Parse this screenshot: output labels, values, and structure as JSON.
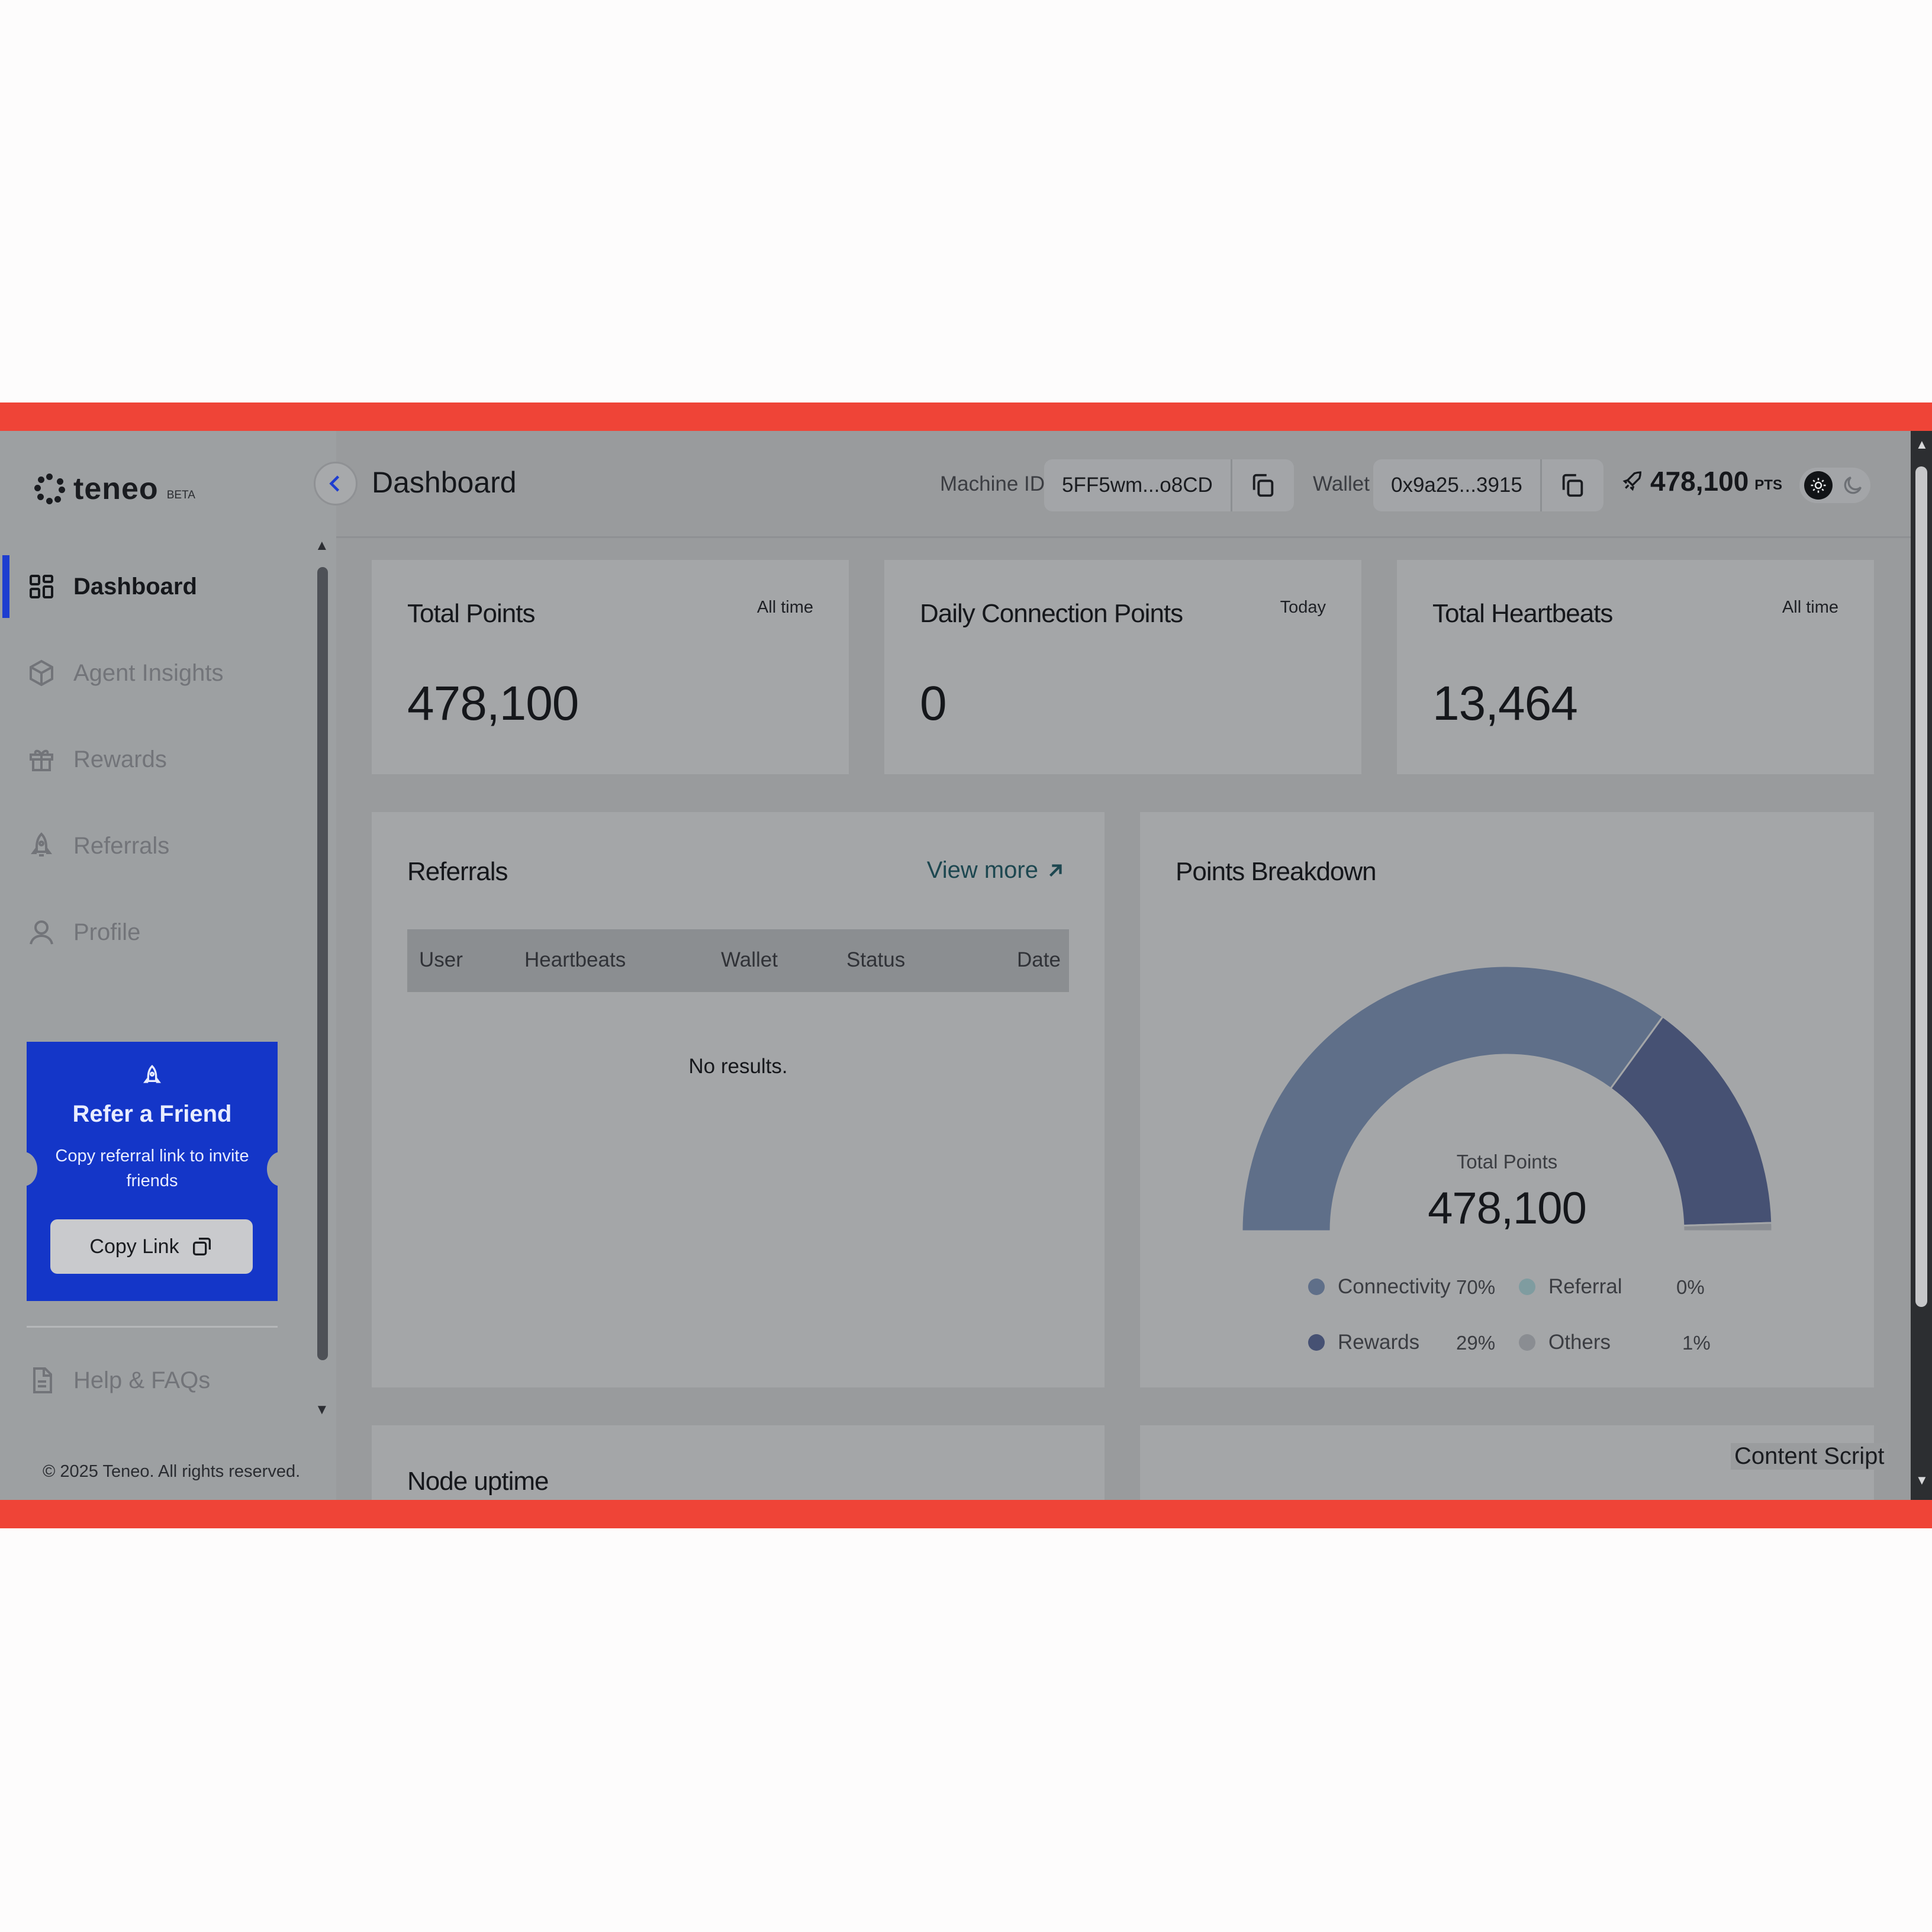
{
  "app": {
    "name": "teneo",
    "badge": "BETA"
  },
  "sidebar": {
    "items": [
      {
        "label": "Dashboard",
        "icon": "dashboard-grid-icon",
        "active": true
      },
      {
        "label": "Agent Insights",
        "icon": "cube-icon"
      },
      {
        "label": "Rewards",
        "icon": "gift-icon"
      },
      {
        "label": "Referrals",
        "icon": "rocket-icon"
      },
      {
        "label": "Profile",
        "icon": "user-icon"
      }
    ],
    "refer": {
      "title": "Refer a Friend",
      "subtitle": "Copy referral link to invite friends",
      "button": "Copy Link"
    },
    "help": "Help & FAQs",
    "copyright": "© 2025 Teneo. All rights reserved."
  },
  "header": {
    "title": "Dashboard",
    "machine_label": "Machine ID",
    "machine_id": "5FF5wm...o8CD",
    "wallet_label": "Wallet",
    "wallet": "0x9a25...3915",
    "points": "478,100",
    "points_unit": "PTS"
  },
  "stats": [
    {
      "title": "Total Points",
      "period": "All time",
      "value": "478,100"
    },
    {
      "title": "Daily Connection Points",
      "period": "Today",
      "value": "0"
    },
    {
      "title": "Total Heartbeats",
      "period": "All time",
      "value": "13,464"
    }
  ],
  "referrals": {
    "title": "Referrals",
    "view_more": "View more",
    "columns": [
      "User",
      "Heartbeats",
      "Wallet",
      "Status",
      "Date"
    ],
    "empty": "No results."
  },
  "breakdown": {
    "title": "Points Breakdown",
    "center_label": "Total Points",
    "center_value": "478,100",
    "segments": [
      {
        "name": "Connectivity",
        "pct_label": "70%",
        "value": 70,
        "color": "#5f6f89"
      },
      {
        "name": "Referral",
        "pct_label": "0%",
        "value": 0,
        "color": "#7f9ca0"
      },
      {
        "name": "Rewards",
        "pct_label": "29%",
        "value": 29,
        "color": "#465173"
      },
      {
        "name": "Others",
        "pct_label": "1%",
        "value": 1,
        "color": "#8a8d92"
      }
    ]
  },
  "node_uptime": {
    "title": "Node uptime"
  },
  "overlay": {
    "content_script": "Content Script"
  },
  "colors": {
    "accent": "#1436c8",
    "frame": "#ef4437",
    "overlay": "#999b9d"
  }
}
